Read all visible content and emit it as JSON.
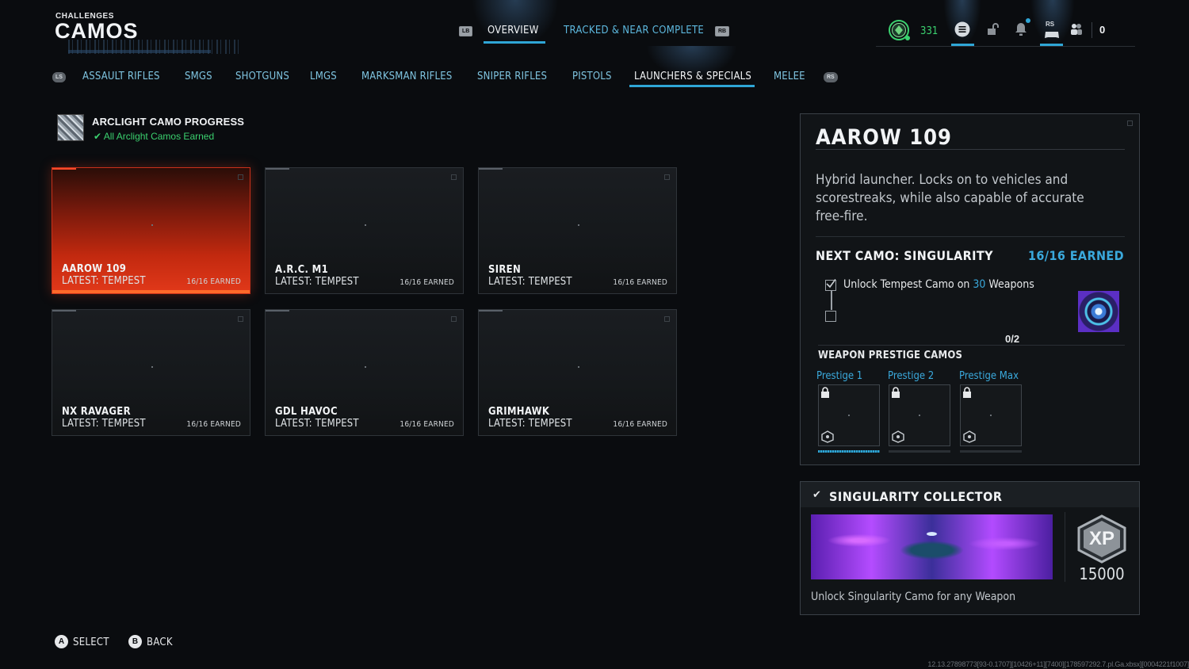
{
  "header": {
    "kicker": "CHALLENGES",
    "title": "CAMOS"
  },
  "top_tabs": {
    "left_button": "LB",
    "right_button": "RB",
    "items": [
      {
        "label": "OVERVIEW",
        "active": true
      },
      {
        "label": "TRACKED & NEAR COMPLETE",
        "active": false
      }
    ]
  },
  "status": {
    "level": "331",
    "currency": "0",
    "rs_button": "RS",
    "icons": [
      "rank-emblem-icon",
      "menu-icon",
      "unlock-icon",
      "notification-bell-icon",
      "controller-icon",
      "party-icon"
    ]
  },
  "categories": {
    "left_button": "LS",
    "right_button": "RS",
    "items": [
      {
        "label": "ASSAULT RIFLES"
      },
      {
        "label": "SMGS"
      },
      {
        "label": "SHOTGUNS"
      },
      {
        "label": "LMGS"
      },
      {
        "label": "MARKSMAN RIFLES"
      },
      {
        "label": "SNIPER RIFLES"
      },
      {
        "label": "PISTOLS"
      },
      {
        "label": "LAUNCHERS & SPECIALS",
        "active": true
      },
      {
        "label": "MELEE"
      }
    ]
  },
  "arclight": {
    "title": "ARCLIGHT CAMO PROGRESS",
    "status": "All Arclight Camos Earned"
  },
  "weapons": [
    {
      "name": "AAROW 109",
      "latest": "LATEST: TEMPEST",
      "earned": "16/16 EARNED",
      "selected": true
    },
    {
      "name": "A.R.C. M1",
      "latest": "LATEST: TEMPEST",
      "earned": "16/16 EARNED"
    },
    {
      "name": "SIREN",
      "latest": "LATEST: TEMPEST",
      "earned": "16/16 EARNED"
    },
    {
      "name": "NX RAVAGER",
      "latest": "LATEST: TEMPEST",
      "earned": "16/16 EARNED"
    },
    {
      "name": "GDL HAVOC",
      "latest": "LATEST: TEMPEST",
      "earned": "16/16 EARNED"
    },
    {
      "name": "GRIMHAWK",
      "latest": "LATEST: TEMPEST",
      "earned": "16/16 EARNED"
    }
  ],
  "detail": {
    "title": "AAROW 109",
    "description": "Hybrid launcher. Locks on to vehicles and scorestreaks, while also capable of accurate free-fire.",
    "next_camo": "NEXT CAMO: SINGULARITY",
    "next_earned": "16/16 EARNED",
    "requirement_prefix": "Unlock Tempest Camo on ",
    "requirement_count": "30",
    "requirement_suffix": " Weapons",
    "progress": "0/2",
    "prestige_heading": "WEAPON PRESTIGE CAMOS",
    "prestige": [
      {
        "label": "Prestige 1",
        "progress": 1.0
      },
      {
        "label": "Prestige 2",
        "progress": 0.0
      },
      {
        "label": "Prestige Max",
        "progress": 0.0
      }
    ]
  },
  "collector": {
    "title": "SINGULARITY COLLECTOR",
    "xp_label": "XP",
    "xp": "15000",
    "description": "Unlock Singularity Camo for any Weapon"
  },
  "footer": {
    "select_key": "A",
    "select_label": "SELECT",
    "back_key": "B",
    "back_label": "BACK"
  },
  "build_string": "12.13.27898773[93-0.1707][10426+11][7400][178597292.7.pl.Ga.xbsx][0004221f1007]",
  "colors": {
    "accent": "#2fa6d6",
    "selected_card": "#c2290f",
    "success": "#3bd16f"
  }
}
